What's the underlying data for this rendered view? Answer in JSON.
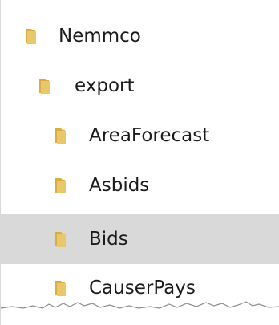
{
  "tree": {
    "items": [
      {
        "label": "Nemmco",
        "icon": "folder-icon",
        "selected": false
      },
      {
        "label": "export",
        "icon": "folder-icon",
        "selected": false
      },
      {
        "label": "AreaForecast",
        "icon": "folder-icon",
        "selected": false
      },
      {
        "label": "Asbids",
        "icon": "folder-icon",
        "selected": false
      },
      {
        "label": "Bids",
        "icon": "folder-icon",
        "selected": true
      },
      {
        "label": "CauserPays",
        "icon": "folder-icon",
        "selected": false
      }
    ]
  },
  "colors": {
    "folder_fill": "#e8c86a",
    "folder_shade": "#d9ad3e",
    "selected_bg": "#d9d9d9",
    "text": "#1b1b1b"
  }
}
